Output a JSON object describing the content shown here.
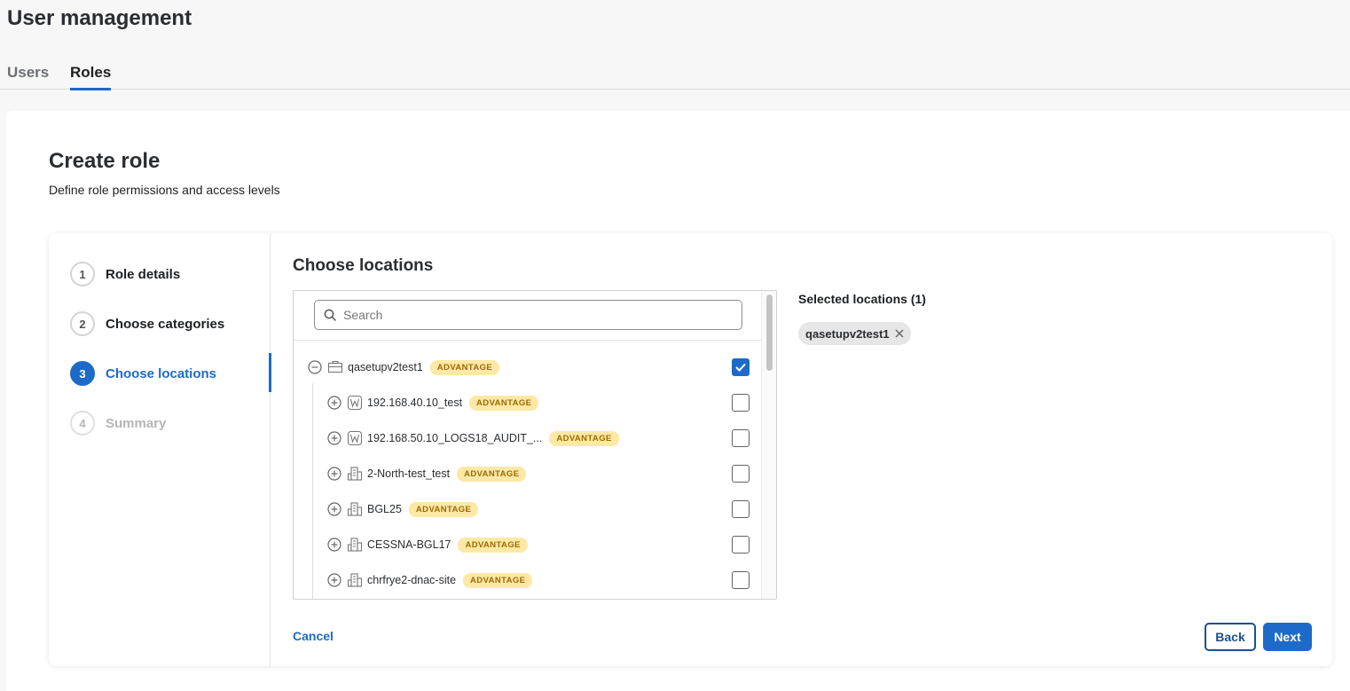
{
  "header": {
    "title": "User management"
  },
  "tabs": [
    {
      "label": "Users"
    },
    {
      "label": "Roles"
    }
  ],
  "card": {
    "title": "Create role",
    "subtitle": "Define role permissions and access levels"
  },
  "steps": [
    {
      "num": "1",
      "label": "Role details"
    },
    {
      "num": "2",
      "label": "Choose categories"
    },
    {
      "num": "3",
      "label": "Choose locations"
    },
    {
      "num": "4",
      "label": "Summary"
    }
  ],
  "locations": {
    "title": "Choose locations",
    "search_placeholder": "Search",
    "tree": [
      {
        "name": "qasetupv2test1",
        "badge": "ADVANTAGE",
        "icon": "global-icon",
        "checked": true
      },
      {
        "name": "192.168.40.10_test",
        "badge": "ADVANTAGE",
        "icon": "wan-icon",
        "checked": false
      },
      {
        "name": "192.168.50.10_LOGS18_AUDIT_...",
        "badge": "ADVANTAGE",
        "icon": "wan-icon",
        "checked": false
      },
      {
        "name": "2-North-test_test",
        "badge": "ADVANTAGE",
        "icon": "building-icon",
        "checked": false
      },
      {
        "name": "BGL25",
        "badge": "ADVANTAGE",
        "icon": "building-icon",
        "checked": false
      },
      {
        "name": "CESSNA-BGL17",
        "badge": "ADVANTAGE",
        "icon": "building-icon",
        "checked": false
      },
      {
        "name": "chrfrye2-dnac-site",
        "badge": "ADVANTAGE",
        "icon": "building-icon",
        "checked": false
      }
    ]
  },
  "selected": {
    "title": "Selected locations (1)",
    "chips": [
      "qasetupv2test1"
    ]
  },
  "footer": {
    "cancel": "Cancel",
    "back": "Back",
    "next": "Next"
  },
  "colors": {
    "accent": "#1d6ac9",
    "badge_bg": "#fde8a6",
    "badge_text": "#9c6b00"
  }
}
